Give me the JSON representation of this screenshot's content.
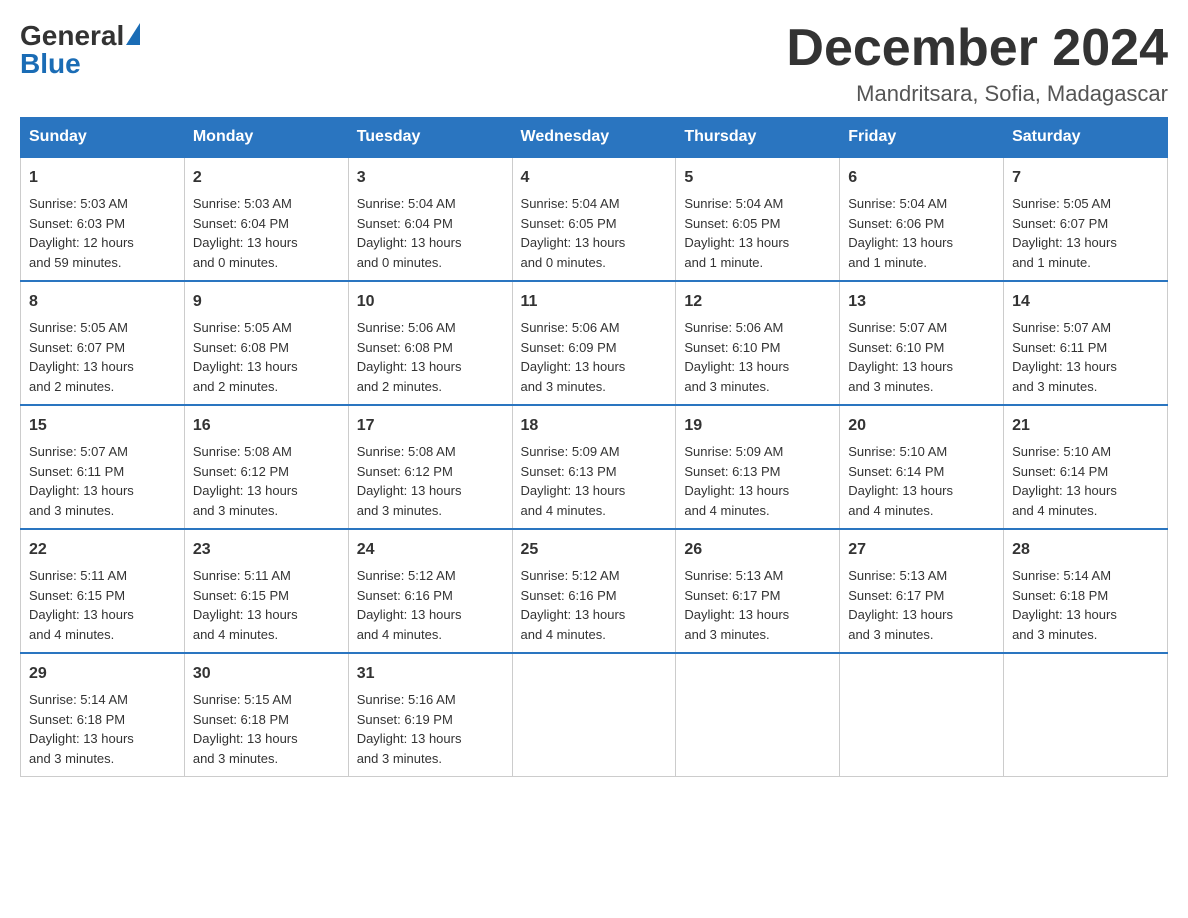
{
  "header": {
    "logo_general": "General",
    "logo_blue": "Blue",
    "month_title": "December 2024",
    "location": "Mandritsara, Sofia, Madagascar"
  },
  "days_of_week": [
    "Sunday",
    "Monday",
    "Tuesday",
    "Wednesday",
    "Thursday",
    "Friday",
    "Saturday"
  ],
  "weeks": [
    [
      {
        "day": "1",
        "info": "Sunrise: 5:03 AM\nSunset: 6:03 PM\nDaylight: 12 hours\nand 59 minutes."
      },
      {
        "day": "2",
        "info": "Sunrise: 5:03 AM\nSunset: 6:04 PM\nDaylight: 13 hours\nand 0 minutes."
      },
      {
        "day": "3",
        "info": "Sunrise: 5:04 AM\nSunset: 6:04 PM\nDaylight: 13 hours\nand 0 minutes."
      },
      {
        "day": "4",
        "info": "Sunrise: 5:04 AM\nSunset: 6:05 PM\nDaylight: 13 hours\nand 0 minutes."
      },
      {
        "day": "5",
        "info": "Sunrise: 5:04 AM\nSunset: 6:05 PM\nDaylight: 13 hours\nand 1 minute."
      },
      {
        "day": "6",
        "info": "Sunrise: 5:04 AM\nSunset: 6:06 PM\nDaylight: 13 hours\nand 1 minute."
      },
      {
        "day": "7",
        "info": "Sunrise: 5:05 AM\nSunset: 6:07 PM\nDaylight: 13 hours\nand 1 minute."
      }
    ],
    [
      {
        "day": "8",
        "info": "Sunrise: 5:05 AM\nSunset: 6:07 PM\nDaylight: 13 hours\nand 2 minutes."
      },
      {
        "day": "9",
        "info": "Sunrise: 5:05 AM\nSunset: 6:08 PM\nDaylight: 13 hours\nand 2 minutes."
      },
      {
        "day": "10",
        "info": "Sunrise: 5:06 AM\nSunset: 6:08 PM\nDaylight: 13 hours\nand 2 minutes."
      },
      {
        "day": "11",
        "info": "Sunrise: 5:06 AM\nSunset: 6:09 PM\nDaylight: 13 hours\nand 3 minutes."
      },
      {
        "day": "12",
        "info": "Sunrise: 5:06 AM\nSunset: 6:10 PM\nDaylight: 13 hours\nand 3 minutes."
      },
      {
        "day": "13",
        "info": "Sunrise: 5:07 AM\nSunset: 6:10 PM\nDaylight: 13 hours\nand 3 minutes."
      },
      {
        "day": "14",
        "info": "Sunrise: 5:07 AM\nSunset: 6:11 PM\nDaylight: 13 hours\nand 3 minutes."
      }
    ],
    [
      {
        "day": "15",
        "info": "Sunrise: 5:07 AM\nSunset: 6:11 PM\nDaylight: 13 hours\nand 3 minutes."
      },
      {
        "day": "16",
        "info": "Sunrise: 5:08 AM\nSunset: 6:12 PM\nDaylight: 13 hours\nand 3 minutes."
      },
      {
        "day": "17",
        "info": "Sunrise: 5:08 AM\nSunset: 6:12 PM\nDaylight: 13 hours\nand 3 minutes."
      },
      {
        "day": "18",
        "info": "Sunrise: 5:09 AM\nSunset: 6:13 PM\nDaylight: 13 hours\nand 4 minutes."
      },
      {
        "day": "19",
        "info": "Sunrise: 5:09 AM\nSunset: 6:13 PM\nDaylight: 13 hours\nand 4 minutes."
      },
      {
        "day": "20",
        "info": "Sunrise: 5:10 AM\nSunset: 6:14 PM\nDaylight: 13 hours\nand 4 minutes."
      },
      {
        "day": "21",
        "info": "Sunrise: 5:10 AM\nSunset: 6:14 PM\nDaylight: 13 hours\nand 4 minutes."
      }
    ],
    [
      {
        "day": "22",
        "info": "Sunrise: 5:11 AM\nSunset: 6:15 PM\nDaylight: 13 hours\nand 4 minutes."
      },
      {
        "day": "23",
        "info": "Sunrise: 5:11 AM\nSunset: 6:15 PM\nDaylight: 13 hours\nand 4 minutes."
      },
      {
        "day": "24",
        "info": "Sunrise: 5:12 AM\nSunset: 6:16 PM\nDaylight: 13 hours\nand 4 minutes."
      },
      {
        "day": "25",
        "info": "Sunrise: 5:12 AM\nSunset: 6:16 PM\nDaylight: 13 hours\nand 4 minutes."
      },
      {
        "day": "26",
        "info": "Sunrise: 5:13 AM\nSunset: 6:17 PM\nDaylight: 13 hours\nand 3 minutes."
      },
      {
        "day": "27",
        "info": "Sunrise: 5:13 AM\nSunset: 6:17 PM\nDaylight: 13 hours\nand 3 minutes."
      },
      {
        "day": "28",
        "info": "Sunrise: 5:14 AM\nSunset: 6:18 PM\nDaylight: 13 hours\nand 3 minutes."
      }
    ],
    [
      {
        "day": "29",
        "info": "Sunrise: 5:14 AM\nSunset: 6:18 PM\nDaylight: 13 hours\nand 3 minutes."
      },
      {
        "day": "30",
        "info": "Sunrise: 5:15 AM\nSunset: 6:18 PM\nDaylight: 13 hours\nand 3 minutes."
      },
      {
        "day": "31",
        "info": "Sunrise: 5:16 AM\nSunset: 6:19 PM\nDaylight: 13 hours\nand 3 minutes."
      },
      {
        "day": "",
        "info": ""
      },
      {
        "day": "",
        "info": ""
      },
      {
        "day": "",
        "info": ""
      },
      {
        "day": "",
        "info": ""
      }
    ]
  ]
}
